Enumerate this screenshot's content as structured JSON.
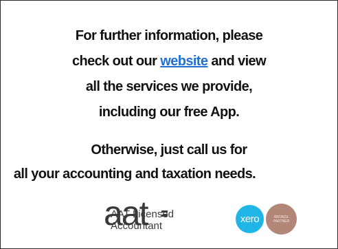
{
  "content": {
    "para1": {
      "line1": "For further information, please",
      "line2_before": "check out our ",
      "link": "website",
      "line2_after": " and view",
      "line3": "all the services we provide,",
      "line4": "including our free App."
    },
    "para2": {
      "line1": "Otherwise, just call us for",
      "line2": "all your accounting and taxation needs."
    }
  },
  "logos": {
    "aat": {
      "wordmark": "aat",
      "label_line1": "AAT Licensed",
      "label_line2": "Accountant"
    },
    "xero": {
      "text": "xero",
      "color": "#1fb5e6"
    },
    "partner_badge": {
      "line1": "BRONZE",
      "line2": "PARTNER",
      "color": "#b38777"
    }
  },
  "colors": {
    "link": "#1f6fd6",
    "text": "#111111"
  }
}
